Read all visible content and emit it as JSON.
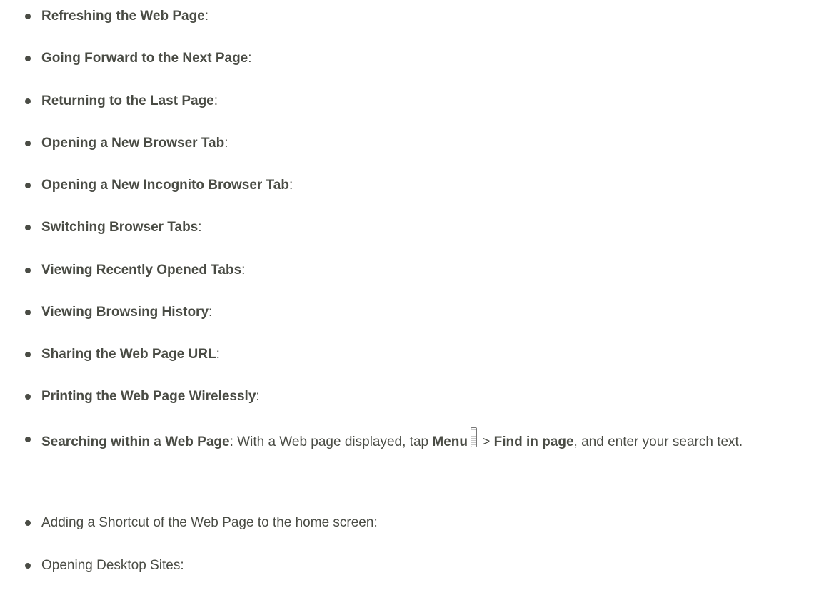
{
  "items": [
    {
      "title": "Refreshing the Web Page",
      "rest": ":"
    },
    {
      "title": "Going Forward to the Next Page",
      "rest": ":"
    },
    {
      "title": "Returning to the Last Page",
      "rest": ":"
    },
    {
      "title": "Opening a New Browser Tab",
      "rest": ":"
    },
    {
      "title": "Opening a New Incognito Browser Tab",
      "rest": ":"
    },
    {
      "title": "Switching Browser Tabs",
      "rest": ":"
    },
    {
      "title": "Viewing Recently Opened Tabs",
      "rest": ":"
    },
    {
      "title": "Viewing Browsing History",
      "rest": ":"
    },
    {
      "title": "Sharing the Web Page URL",
      "rest": ":"
    },
    {
      "title": "Printing the Web Page Wirelessly",
      "rest": ":"
    },
    {
      "title": "Searching within a Web Page",
      "rest": ": With a Web page displayed, tap ",
      "menu_label": "Menu",
      "menu_icon": "menu-icon",
      "separator": " > ",
      "action": "Find in page",
      "tail": ", and enter your search text."
    },
    {
      "plain": "Adding a Shortcut of the Web Page to the home screen:"
    },
    {
      "plain": "Opening Desktop Sites:"
    }
  ]
}
